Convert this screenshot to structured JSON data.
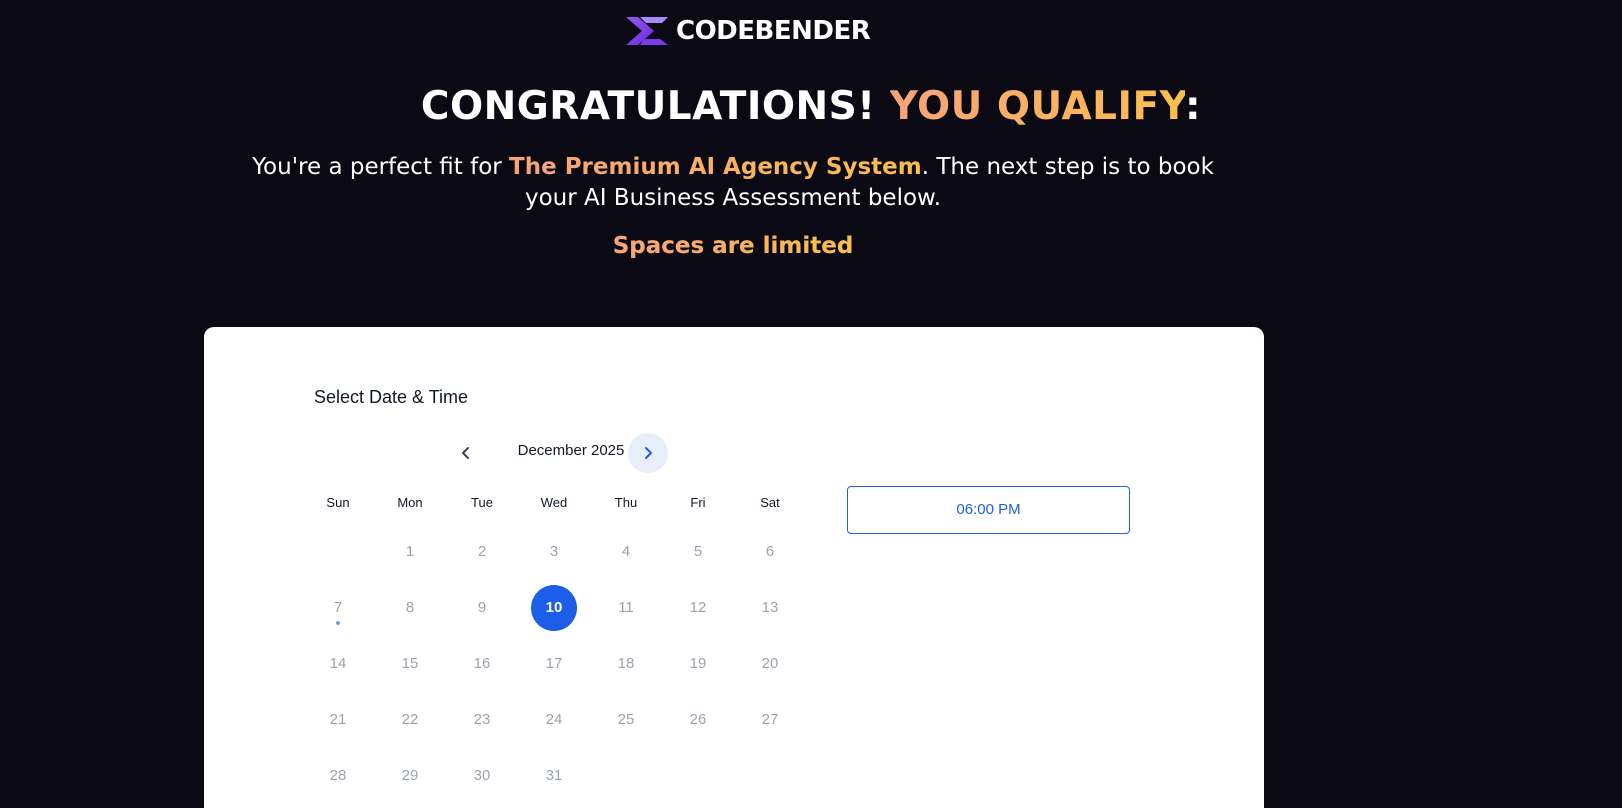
{
  "brand": {
    "logo_text": "CODEBENDER"
  },
  "hero": {
    "title_main": "CONGRATULATIONS!",
    "title_accent": "YOU QUALIFY",
    "title_suffix": ":",
    "sub_prefix": "You're a perfect fit for ",
    "sub_highlight": "The Premium AI Agency System",
    "sub_suffix": ". The next step is to book your AI Business Assessment below.",
    "limited": "Spaces are limited"
  },
  "booking": {
    "title": "Select Date & Time",
    "month_label": "December 2025",
    "prev_icon": "chevron-left-icon",
    "next_icon": "chevron-right-icon",
    "weekdays": [
      "Sun",
      "Mon",
      "Tue",
      "Wed",
      "Thu",
      "Fri",
      "Sat"
    ],
    "selected_day": "10",
    "time_slot": "06:00 PM"
  },
  "colors": {
    "background": "#0b0a14",
    "accent_gradient_start": "#f7a27a",
    "accent_gradient_end": "#fbbf4d",
    "primary_blue": "#1d5ee8",
    "logo_purple": "#7c3aed"
  }
}
